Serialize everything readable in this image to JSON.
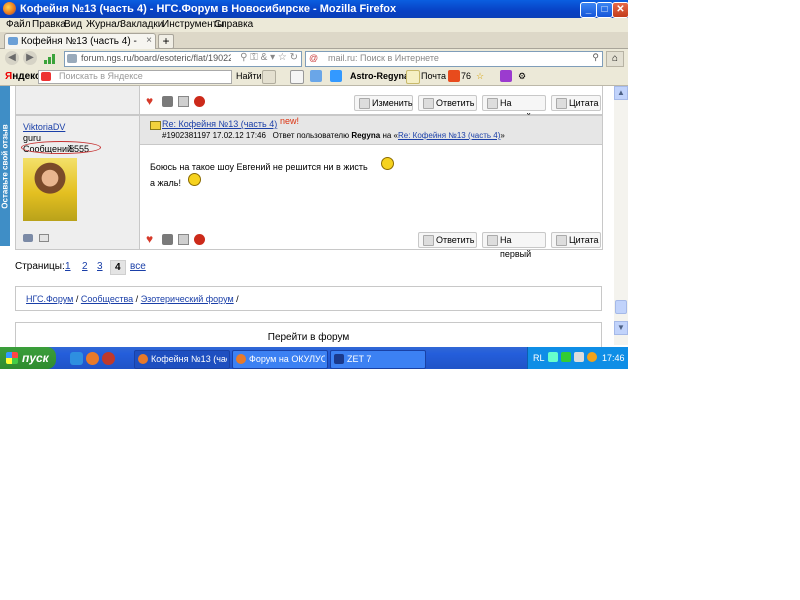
{
  "window": {
    "title": "Кофейня №13 (часть 4) - НГС.Форум в Новосибирске - Mozilla Firefox",
    "minimize": "_",
    "maximize": "□",
    "close": "✕"
  },
  "menu": [
    "Файл",
    "Правка",
    "Вид",
    "Журнал",
    "Закладки",
    "Инструменты",
    "Справка"
  ],
  "tab": {
    "label": "Кофейня №13 (часть 4) - НГС.Форум в Но...",
    "close": "×",
    "new_tab": "+"
  },
  "nav": {
    "url": "forum.ngs.ru/board/esoteric/flat/1902276557/?fpart",
    "search_placeholder": "mail.ru: Поиск в Интернете",
    "search_prefix": "@"
  },
  "yandex": {
    "logo_first": "Я",
    "logo_rest": "ндекс",
    "search_placeholder": "Поискать в Яндексе",
    "find": "Найти",
    "astro": "Astro-Regyna",
    "mail": "Почта",
    "count": "76"
  },
  "post1": {
    "buttons": [
      "Изменить",
      "Ответить",
      "На первый",
      "Цитата"
    ]
  },
  "post2": {
    "author": "ViktoriaDV",
    "rank": "guru",
    "messages_label": "Сообщений:",
    "messages_count": "5555",
    "title_link": "Re: Кофейня №13 (часть 4)",
    "new_badge": "new!",
    "meta_prefix": "#1902381197 17.02.12 17:46",
    "meta_reply": "Ответ пользователю",
    "meta_user": "Regyna",
    "meta_on": "на «",
    "meta_link": "Re: Кофейня №13 (часть 4)",
    "meta_end": "»",
    "line1": "Боюсь на такое шоу Евгений не решится ни в жисть",
    "line2": "а жаль!",
    "buttons": [
      "Ответить",
      "На первый",
      "Цитата"
    ]
  },
  "feedback_tab": "Оставьте свой отзыв",
  "pager": {
    "label": "Страницы:",
    "pages": [
      "1",
      "2",
      "3",
      "4"
    ],
    "all": "все"
  },
  "breadcrumb": {
    "items": [
      "НГС.Форум",
      "Сообщества",
      "Эзотерический форум"
    ],
    "sep": "/"
  },
  "go_forum": "Перейти в форум",
  "taskbar": {
    "start": "пуск",
    "tasks": [
      "Кофейня №13 (част...",
      "Форум на ОКУЛУС - ...",
      "ZET 7"
    ],
    "lang": "RL",
    "clock": "17:46"
  }
}
